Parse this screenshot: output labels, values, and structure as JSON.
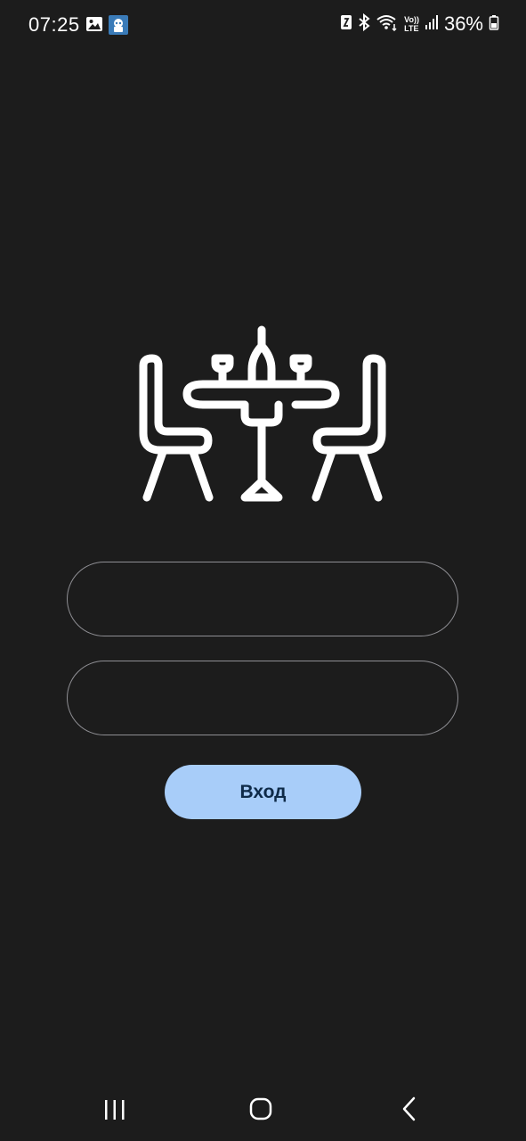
{
  "status_bar": {
    "time": "07:25",
    "left_icons": [
      "gallery-icon",
      "app-notification-icon"
    ],
    "right_icons": [
      "nfc-icon",
      "bluetooth-icon",
      "wifi-icon",
      "volte-icon",
      "signal-icon"
    ],
    "volte_label_top": "Vo))",
    "volte_label_bottom": "LTE",
    "battery": "36%"
  },
  "logo": {
    "icon": "restaurant-table-icon"
  },
  "form": {
    "login_value": "",
    "login_placeholder": "",
    "password_value": "",
    "password_placeholder": "",
    "submit_label": "Вход"
  },
  "colors": {
    "background": "#1c1c1c",
    "field_border": "#8e8e93",
    "button_bg": "#a8cdf9",
    "button_text": "#0e2a48"
  },
  "nav_bar": {
    "items": [
      "recent-apps-icon",
      "home-icon",
      "back-icon"
    ]
  }
}
